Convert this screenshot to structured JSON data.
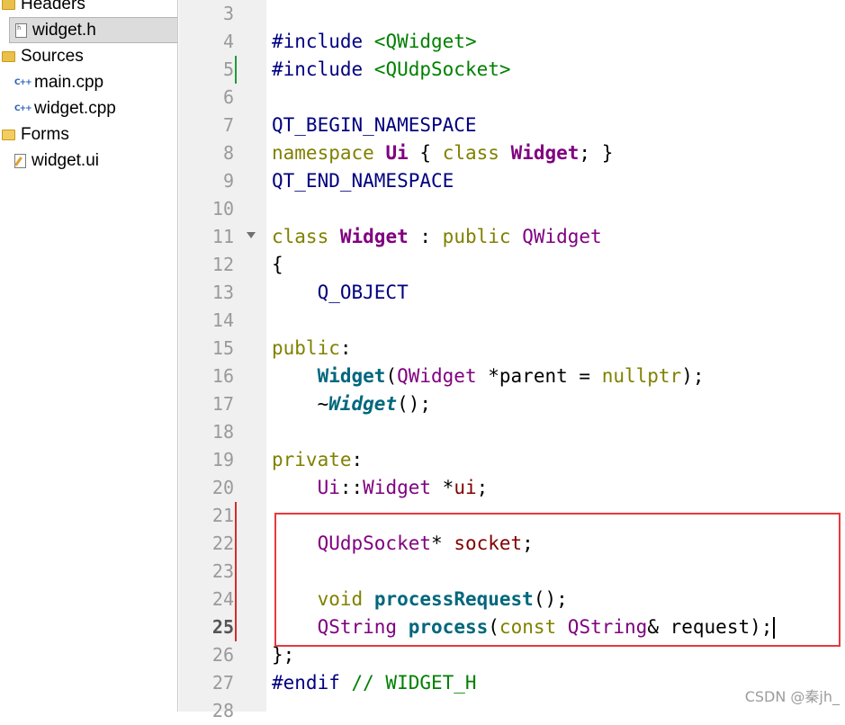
{
  "project_tree": {
    "headers_label": "Headers",
    "header_file": "widget.h",
    "sources_label": "Sources",
    "source_files": [
      "main.cpp",
      "widget.cpp"
    ],
    "forms_label": "Forms",
    "form_file": "widget.ui",
    "icons": {
      "folder": "folder-icon",
      "header": "header-file-icon",
      "cpp": "cpp-file-icon",
      "ui": "ui-file-icon"
    }
  },
  "editor": {
    "current_line": "25",
    "line_numbers": [
      "3",
      "4",
      "5",
      "6",
      "7",
      "8",
      "9",
      "10",
      "11",
      "12",
      "13",
      "14",
      "15",
      "16",
      "17",
      "18",
      "19",
      "20",
      "21",
      "22",
      "23",
      "24",
      "25",
      "26",
      "27",
      "28"
    ],
    "lines": {
      "l4": [
        "#include",
        " <QWidget>"
      ],
      "l5": [
        "#include",
        " <QUdpSocket>"
      ],
      "l7": [
        "QT_BEGIN_NAMESPACE"
      ],
      "l8": [
        "namespace",
        " ",
        "Ui",
        " { ",
        "class",
        " ",
        "Widget",
        "; }"
      ],
      "l9": [
        "QT_END_NAMESPACE"
      ],
      "l11": [
        "class",
        " ",
        "Widget",
        " : ",
        "public",
        " ",
        "QWidget"
      ],
      "l12": [
        "{"
      ],
      "l13": [
        "    ",
        "Q_OBJECT"
      ],
      "l15": [
        "public",
        ":"
      ],
      "l16": [
        "    ",
        "Widget",
        "(",
        "QWidget",
        " *parent = ",
        "nullptr",
        ");"
      ],
      "l17": [
        "    ~",
        "Widget",
        "();"
      ],
      "l19": [
        "private",
        ":"
      ],
      "l20": [
        "    ",
        "Ui",
        "::",
        "Widget",
        " *",
        "ui",
        ";"
      ],
      "l22": [
        "    ",
        "QUdpSocket",
        "* ",
        "socket",
        ";"
      ],
      "l24": [
        "    ",
        "void",
        " ",
        "processRequest",
        "();"
      ],
      "l25": [
        "    ",
        "QString",
        " ",
        "process",
        "(",
        "const",
        " ",
        "QString",
        "& request);"
      ],
      "l26": [
        "};"
      ],
      "l27": [
        "#endif",
        " // WIDGET_H"
      ]
    },
    "colors": {
      "keyword": "#808000",
      "type": "#800080",
      "function": "#00677c",
      "include": "#008000",
      "highlight_box": "#e8383d"
    }
  },
  "watermark": "CSDN @秦jh_"
}
